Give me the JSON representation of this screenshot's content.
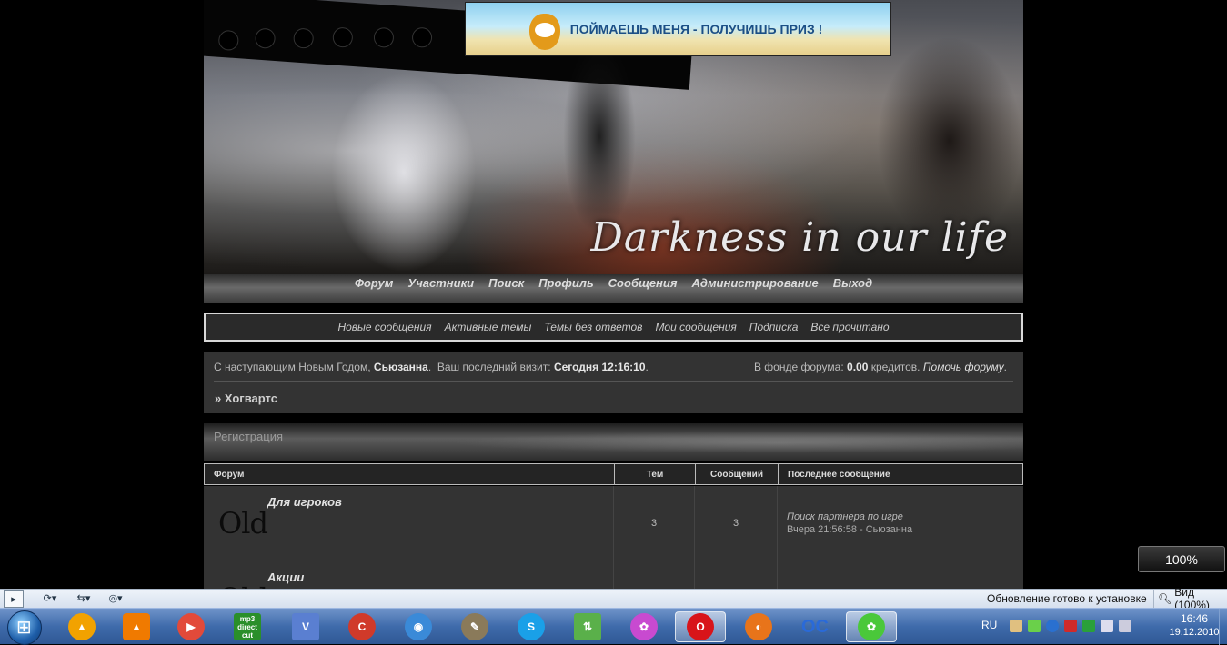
{
  "banner": {
    "logo_text": "Darkness in our life",
    "ad_text": "ПОЙМАЕШЬ МЕНЯ - ПОЛУЧИШЬ ПРИЗ !"
  },
  "main_nav": [
    "Форум",
    "Участники",
    "Поиск",
    "Профиль",
    "Сообщения",
    "Администрирование",
    "Выход"
  ],
  "sub_nav": [
    "Новые сообщения",
    "Активные темы",
    "Темы без ответов",
    "Мои сообщения",
    "Подписка",
    "Все прочитано"
  ],
  "info": {
    "greeting": "С наступающим Новым Годом,",
    "username": "Сьюзанна",
    "last_visit_label": "Ваш последний визит:",
    "last_visit_value": "Сегодня 12:16:10",
    "fund_label": "В фонде форума:",
    "fund_value": "0.00",
    "fund_unit": "кредитов.",
    "help_link": "Помочь форуму",
    "breadcrumb": "» Хогвартс"
  },
  "category_title": "Регистрация",
  "table": {
    "headers": [
      "Форум",
      "Тем",
      "Сообщений",
      "Последнее сообщение"
    ],
    "rows": [
      {
        "icon_text": "Old",
        "name": "Для игроков",
        "topics": "3",
        "posts": "3",
        "last_title": "Поиск партнера по игре",
        "last_meta": "Вчера 21:56:58 - Сьюзанна"
      },
      {
        "icon_text": "Old",
        "name": "Акции",
        "topics": "",
        "posts": "",
        "last_title": "",
        "last_meta": ""
      }
    ]
  },
  "zoom_popup": "100%",
  "statusbar": {
    "update_text": "Обновление готово к установке",
    "zoom_text": "Вид (100%)"
  },
  "taskbar": {
    "language": "RU",
    "time": "16:46",
    "date": "19.12.2010",
    "apps": [
      {
        "name": "aimp-icon",
        "label": "",
        "color": "#f2a200"
      },
      {
        "name": "vlc-icon",
        "label": "",
        "color": "#f07a00"
      },
      {
        "name": "media-player-icon",
        "label": "",
        "color": "#e24a3a"
      },
      {
        "name": "mp3-directcut-icon",
        "label": "mp3 direct cut",
        "color": "#2a8f2a"
      },
      {
        "name": "virtualdub-icon",
        "label": "",
        "color": "#5a7fd1"
      },
      {
        "name": "ccleaner-icon",
        "label": "",
        "color": "#d03a2a"
      },
      {
        "name": "disc-burner-icon",
        "label": "",
        "color": "#3a8ad8"
      },
      {
        "name": "gimp-icon",
        "label": "",
        "color": "#8a7a5a"
      },
      {
        "name": "skype-icon",
        "label": "",
        "color": "#1aa0e8"
      },
      {
        "name": "network-icon",
        "label": "",
        "color": "#5ab04a"
      },
      {
        "name": "picasa-icon",
        "label": "",
        "color": "#c84ad0"
      },
      {
        "name": "opera-icon",
        "label": "",
        "color": "#d8141a"
      },
      {
        "name": "firefox-icon",
        "label": "",
        "color": "#e8741a"
      },
      {
        "name": "oc-icon",
        "label": "OC",
        "color": "#2a6ad8"
      },
      {
        "name": "icq-icon",
        "label": "",
        "color": "#4ac83a"
      }
    ]
  }
}
